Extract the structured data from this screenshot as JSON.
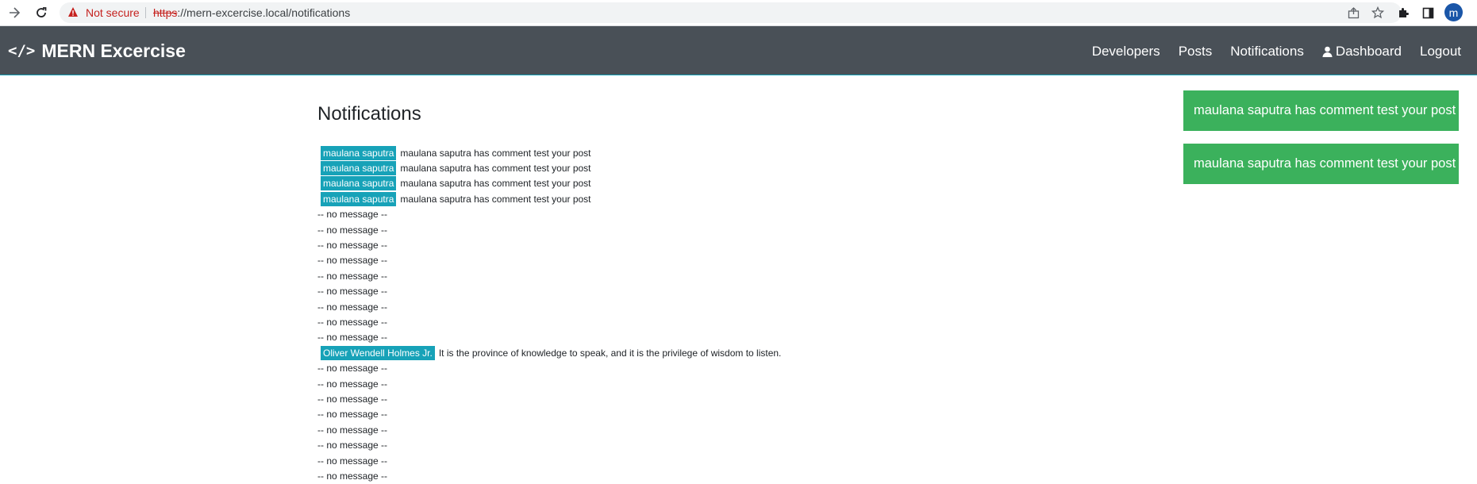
{
  "browser": {
    "not_secure_label": "Not secure",
    "url_scheme": "https",
    "url_rest": "://mern-excercise.local/notifications",
    "avatar_letter": "m"
  },
  "navbar": {
    "brand_icon": "</>",
    "brand_title": "MERN Excercise",
    "links": [
      "Developers",
      "Posts",
      "Notifications",
      "Dashboard",
      "Logout"
    ]
  },
  "page": {
    "title": "Notifications"
  },
  "notifications": [
    {
      "sender": "maulana saputra",
      "message": "maulana saputra has comment test your post"
    },
    {
      "sender": "maulana saputra",
      "message": "maulana saputra has comment test your post"
    },
    {
      "sender": "maulana saputra",
      "message": "maulana saputra has comment test your post"
    },
    {
      "sender": "maulana saputra",
      "message": "maulana saputra has comment test your post"
    },
    {
      "sender": "",
      "message": "-- no message --"
    },
    {
      "sender": "",
      "message": "-- no message --"
    },
    {
      "sender": "",
      "message": "-- no message --"
    },
    {
      "sender": "",
      "message": "-- no message --"
    },
    {
      "sender": "",
      "message": "-- no message --"
    },
    {
      "sender": "",
      "message": "-- no message --"
    },
    {
      "sender": "",
      "message": "-- no message --"
    },
    {
      "sender": "",
      "message": "-- no message --"
    },
    {
      "sender": "",
      "message": "-- no message --"
    },
    {
      "sender": "Oliver Wendell Holmes Jr.",
      "message": "It is the province of knowledge to speak, and it is the privilege of wisdom to listen."
    },
    {
      "sender": "",
      "message": "-- no message --"
    },
    {
      "sender": "",
      "message": "-- no message --"
    },
    {
      "sender": "",
      "message": "-- no message --"
    },
    {
      "sender": "",
      "message": "-- no message --"
    },
    {
      "sender": "",
      "message": "-- no message --"
    },
    {
      "sender": "",
      "message": "-- no message --"
    },
    {
      "sender": "",
      "message": "-- no message --"
    },
    {
      "sender": "",
      "message": "-- no message --"
    }
  ],
  "toasts": [
    "maulana saputra has comment test your post",
    "maulana saputra has comment test your post"
  ],
  "colors": {
    "navbar_bg": "#495057",
    "badge_bg": "#17a2b8",
    "toast_bg": "#3bb15c",
    "not_secure": "#c5221f"
  },
  "icons": {
    "back": "back-arrow-icon",
    "reload": "reload-icon",
    "warning": "warning-icon",
    "share": "share-icon",
    "star": "star-icon",
    "extensions": "puzzle-icon",
    "sidepanel": "side-panel-icon",
    "brand": "code-icon",
    "user": "user-icon"
  }
}
